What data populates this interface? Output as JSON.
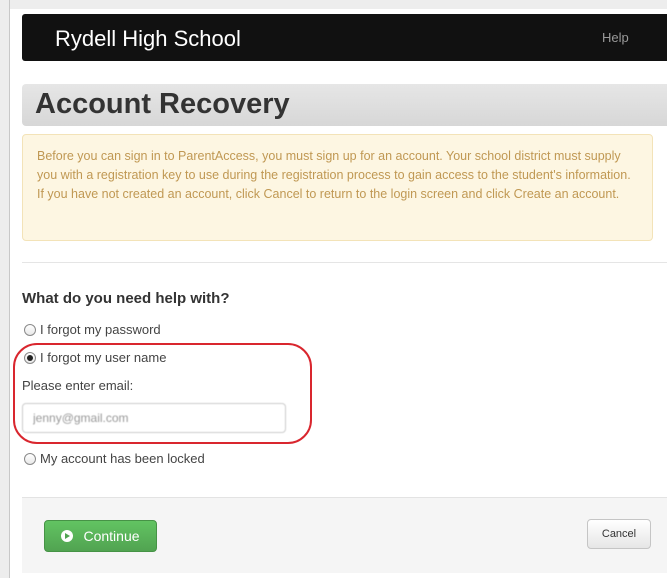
{
  "header": {
    "brand": "Rydell High School",
    "help_label": "Help"
  },
  "page": {
    "title": "Account Recovery"
  },
  "alert": {
    "text": "Before you can sign in to ParentAccess, you must sign up for an account. Your school district must supply you with a registration key to use during the registration process to gain access to the student's information. If you have not created an account, click Cancel to return to the login screen and click Create an account."
  },
  "form": {
    "question": "What do you need help with?",
    "options": [
      {
        "label": "I forgot my password",
        "checked": false
      },
      {
        "label": "I forgot my user name",
        "checked": true
      },
      {
        "label": "My account has been locked",
        "checked": false
      }
    ],
    "email_label": "Please enter email:",
    "email_value": "jenny@gmail.com"
  },
  "footer": {
    "continue_label": "Continue",
    "cancel_label": "Cancel"
  },
  "colors": {
    "alert_text": "#c09853",
    "alert_bg": "#fdf6e2",
    "continue_green": "#51a351",
    "highlight_red": "#d9262e"
  }
}
